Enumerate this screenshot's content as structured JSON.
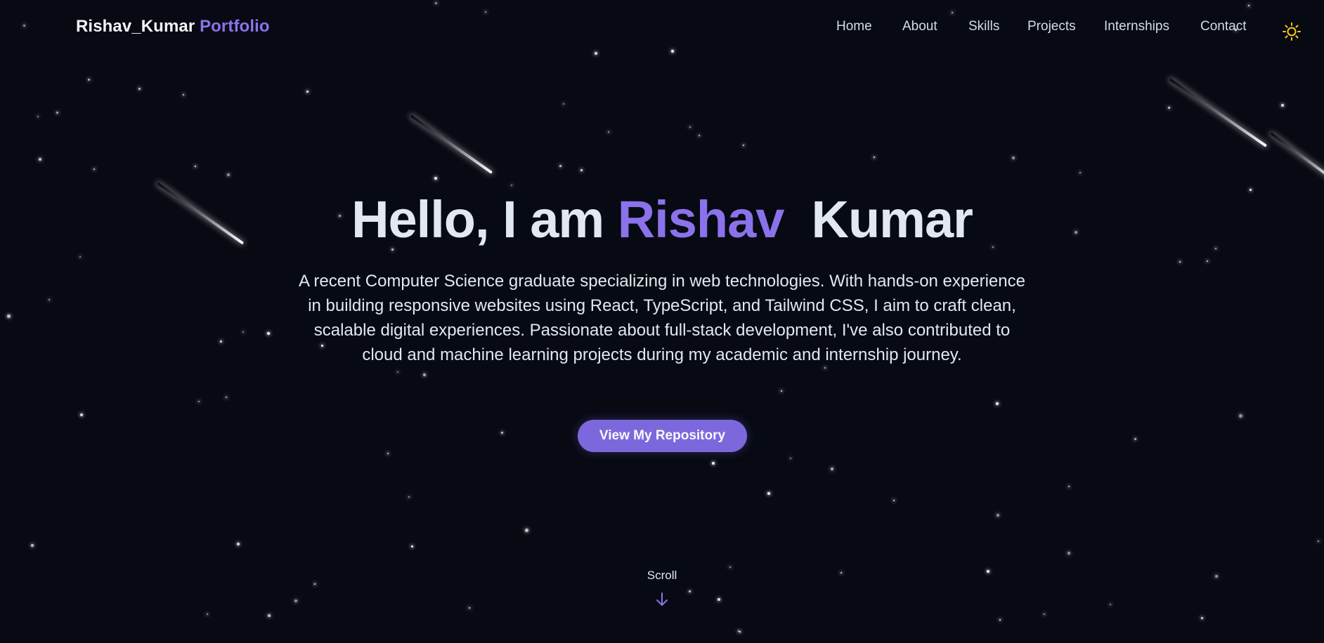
{
  "header": {
    "logo_name": "Rishav_Kumar",
    "logo_accent": "Portfolio",
    "nav_items": [
      {
        "label": "Home"
      },
      {
        "label": "About"
      },
      {
        "label": "Skills"
      },
      {
        "label": "Projects"
      },
      {
        "label": "Internships"
      },
      {
        "label": "Contact"
      }
    ],
    "theme_toggle_icon": "sun-icon"
  },
  "hero": {
    "title_prefix": "Hello, I am",
    "title_highlight": "Rishav",
    "title_suffix": "Kumar",
    "description": "A recent Computer Science graduate specializing in web technologies. With hands-on experience in building responsive websites using React, TypeScript, and Tailwind CSS, I aim to craft clean, scalable digital experiences. Passionate about full-stack development, I've also contributed to cloud and machine learning projects during my academic and internship journey.",
    "cta_label": "View My Repository"
  },
  "scroll": {
    "label": "Scroll",
    "icon": "arrow-down-icon"
  },
  "colors": {
    "background": "#070a13",
    "accent": "#8b72ea",
    "button": "#7c68dc",
    "text": "#e2e8f0",
    "sun": "#facc15"
  }
}
